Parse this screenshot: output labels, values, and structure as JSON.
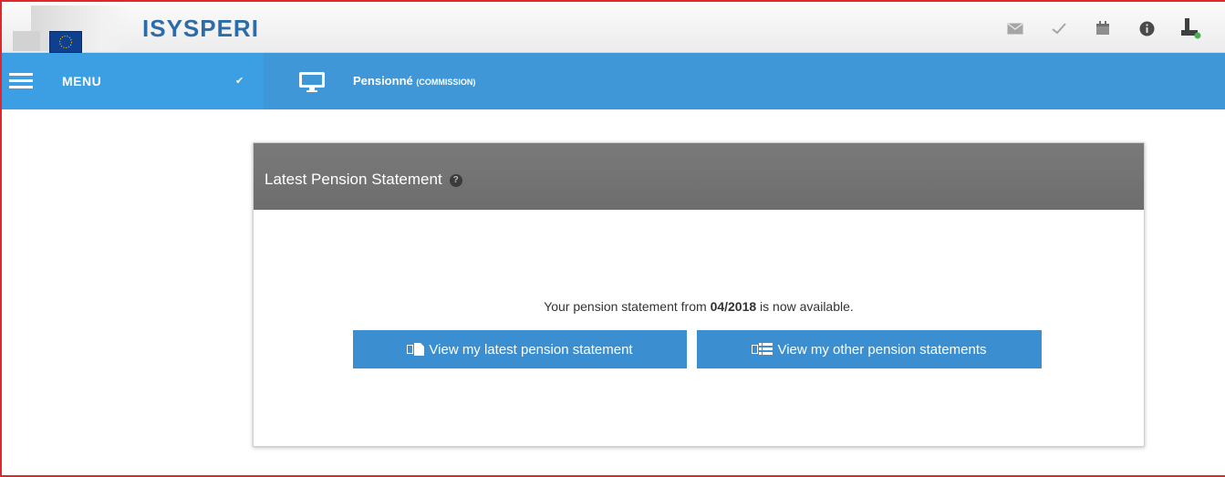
{
  "header": {
    "brand": "ISYSPERI",
    "icons": [
      "envelope-icon",
      "check-icon",
      "calendar-icon",
      "info-icon",
      "user-icon"
    ]
  },
  "nav": {
    "menu_label": "MENU",
    "context_title": "Pensionné",
    "context_sub": "(COMMISSION)"
  },
  "panel": {
    "title": "Latest Pension Statement",
    "message_prefix": "Your pension statement from ",
    "message_date": "04/2018",
    "message_suffix": " is now available.",
    "btn_latest": "View my latest pension statement",
    "btn_other": "View my other pension statements"
  },
  "colors": {
    "accent": "#3f97d8",
    "button": "#3b8ed0",
    "panel_header": "#727272",
    "brand": "#2d6ca8",
    "frame": "#e3262c"
  }
}
